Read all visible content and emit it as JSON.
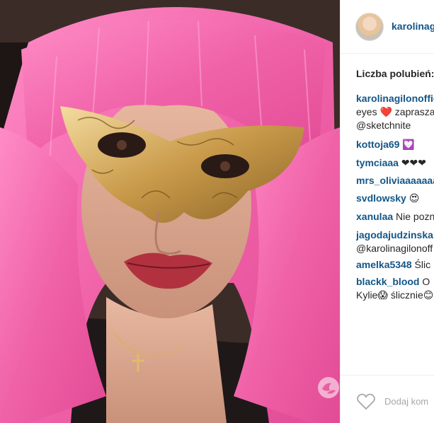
{
  "post": {
    "username": "karolinagi",
    "likes_label": "Liczba polubień:",
    "comments": [
      {
        "author": "karolinagilonoffic",
        "line2": "eyes ❤️ zapraszam",
        "line3": "@sketchnite"
      },
      {
        "author": "kottoja69",
        "text": "💟"
      },
      {
        "author": "tymciaaa",
        "text": "❤❤❤"
      },
      {
        "author": "mrs_oliviaaaaaaa",
        "text": ""
      },
      {
        "author": "svdlowsky",
        "text": "😍"
      },
      {
        "author": "xanulaa",
        "text": "Nie pozn"
      },
      {
        "author": "jagodajudzinska",
        "line2": "@karolinagilonoff"
      },
      {
        "author": "amelka5348",
        "text": "Ślic"
      },
      {
        "author": "blackk_blood",
        "text": "O",
        "line2": "Kylie😱 ślicznie😊"
      }
    ],
    "add_comment_placeholder": "Dodaj kom"
  },
  "icons": {
    "heart": "heart-outline-icon",
    "watermark": "site-logo-icon"
  },
  "colors": {
    "username": "#125688",
    "text": "#262626",
    "hair": "#f06aa8",
    "placeholder": "#a5a7aa"
  }
}
